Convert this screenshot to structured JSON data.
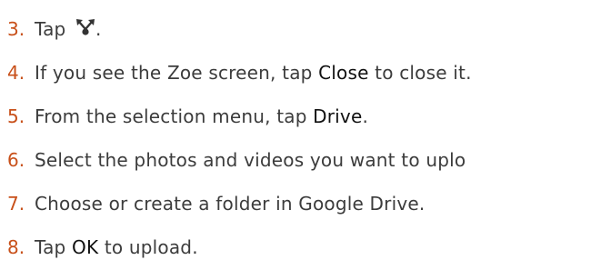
{
  "steps": [
    {
      "number": "3.",
      "text_before": "Tap ",
      "icon": "share-icon",
      "text_after": "."
    },
    {
      "number": "4.",
      "text_before": "If you see the Zoe screen, tap ",
      "term": "Close",
      "text_after": " to close it."
    },
    {
      "number": "5.",
      "text_before": "From the selection menu, tap ",
      "term": "Drive",
      "text_after": "."
    },
    {
      "number": "6.",
      "text": "Select the photos and videos you want to uplo"
    },
    {
      "number": "7.",
      "text": "Choose or create a folder in Google Drive."
    },
    {
      "number": "8.",
      "text_before": "Tap ",
      "term": "OK",
      "text_after": " to upload."
    }
  ],
  "colors": {
    "step_number": "#c8501a",
    "body_text": "#3c3c3c",
    "term": "#111111",
    "icon": "#333333"
  }
}
